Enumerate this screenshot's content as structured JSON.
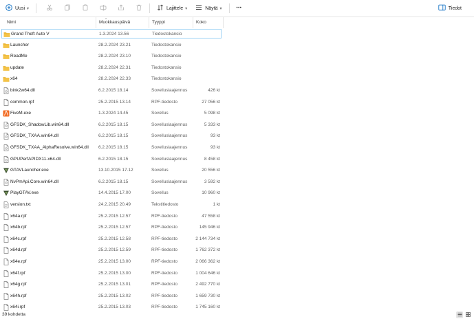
{
  "toolbar": {
    "new_label": "Uusi",
    "sort_label": "Lajittele",
    "view_label": "Näytä",
    "more_label": "•••",
    "details_label": "Tiedot"
  },
  "columns": {
    "name": "Nimi",
    "modified": "Muokkauspäivä",
    "type": "Tyyppi",
    "size": "Koko"
  },
  "files": [
    {
      "name": "Grand Theft Auto V",
      "modified": "1.3.2024 13.56",
      "type": "Tiedostokansio",
      "size": "",
      "icon": "folder-icon"
    },
    {
      "name": "Launcher",
      "modified": "28.2.2024 23.21",
      "type": "Tiedostokansio",
      "size": "",
      "icon": "folder-icon"
    },
    {
      "name": "ReadMe",
      "modified": "28.2.2024 23.10",
      "type": "Tiedostokansio",
      "size": "",
      "icon": "folder-icon"
    },
    {
      "name": "update",
      "modified": "28.2.2024 22.31",
      "type": "Tiedostokansio",
      "size": "",
      "icon": "folder-icon"
    },
    {
      "name": "x64",
      "modified": "28.2.2024 22.33",
      "type": "Tiedostokansio",
      "size": "",
      "icon": "folder-icon"
    },
    {
      "name": "bink2w64.dll",
      "modified": "6.2.2015 18.14",
      "type": "Sovelluslaajennus",
      "size": "426 kt",
      "icon": "dll-file-icon"
    },
    {
      "name": "common.rpf",
      "modified": "25.2.2015 13.14",
      "type": "RPF-tiedosto",
      "size": "27 056 kt",
      "icon": "file-icon"
    },
    {
      "name": "FiveM.exe",
      "modified": "1.3.2024 14.45",
      "type": "Sovellus",
      "size": "5 098 kt",
      "icon": "fivem-app-icon"
    },
    {
      "name": "GFSDK_ShadowLib.win64.dll",
      "modified": "6.2.2015 18.15",
      "type": "Sovelluslaajennus",
      "size": "5 333 kt",
      "icon": "dll-file-icon"
    },
    {
      "name": "GFSDK_TXAA.win64.dll",
      "modified": "6.2.2015 18.15",
      "type": "Sovelluslaajennus",
      "size": "93 kt",
      "icon": "dll-file-icon"
    },
    {
      "name": "GFSDK_TXAA_AlphaResolve.win64.dll",
      "modified": "6.2.2015 18.15",
      "type": "Sovelluslaajennus",
      "size": "93 kt",
      "icon": "dll-file-icon"
    },
    {
      "name": "GPUPerfAPIDX11-x64.dll",
      "modified": "6.2.2015 18.15",
      "type": "Sovelluslaajennus",
      "size": "8 458 kt",
      "icon": "dll-file-icon"
    },
    {
      "name": "GTAVLauncher.exe",
      "modified": "13.10.2015 17.12",
      "type": "Sovellus",
      "size": "20 556 kt",
      "icon": "gtav-app-icon"
    },
    {
      "name": "NvPmApi.Core.win64.dll",
      "modified": "6.2.2015 18.15",
      "type": "Sovelluslaajennus",
      "size": "3 592 kt",
      "icon": "dll-file-icon"
    },
    {
      "name": "PlayGTAV.exe",
      "modified": "14.4.2015 17.00",
      "type": "Sovellus",
      "size": "10 960 kt",
      "icon": "gtav-app-icon"
    },
    {
      "name": "version.txt",
      "modified": "24.2.2015 20.49",
      "type": "Tekstitiedosto",
      "size": "1 kt",
      "icon": "text-file-icon"
    },
    {
      "name": "x64a.rpf",
      "modified": "25.2.2015 12.57",
      "type": "RPF-tiedosto",
      "size": "47 558 kt",
      "icon": "file-icon"
    },
    {
      "name": "x64b.rpf",
      "modified": "25.2.2015 12.57",
      "type": "RPF-tiedosto",
      "size": "145 946 kt",
      "icon": "file-icon"
    },
    {
      "name": "x64c.rpf",
      "modified": "25.2.2015 12.58",
      "type": "RPF-tiedosto",
      "size": "2 144 734 kt",
      "icon": "file-icon"
    },
    {
      "name": "x64d.rpf",
      "modified": "25.2.2015 12.59",
      "type": "RPF-tiedosto",
      "size": "1 762 372 kt",
      "icon": "file-icon"
    },
    {
      "name": "x64e.rpf",
      "modified": "25.2.2015 13.00",
      "type": "RPF-tiedosto",
      "size": "2 066 362 kt",
      "icon": "file-icon"
    },
    {
      "name": "x64f.rpf",
      "modified": "25.2.2015 13.00",
      "type": "RPF-tiedosto",
      "size": "1 004 646 kt",
      "icon": "file-icon"
    },
    {
      "name": "x64g.rpf",
      "modified": "25.2.2015 13.01",
      "type": "RPF-tiedosto",
      "size": "2 492 770 kt",
      "icon": "file-icon"
    },
    {
      "name": "x64h.rpf",
      "modified": "25.2.2015 13.02",
      "type": "RPF-tiedosto",
      "size": "1 659 730 kt",
      "icon": "file-icon"
    },
    {
      "name": "x64i.rpf",
      "modified": "25.2.2015 13.03",
      "type": "RPF-tiedosto",
      "size": "1 745 160 kt",
      "icon": "file-icon"
    }
  ],
  "status": {
    "item_count": "39 kohdetta"
  },
  "colors": {
    "folder": "#f4c347",
    "folder_dark": "#e3a81b",
    "selection_border": "#9fd3f5",
    "accent": "#0067c0"
  }
}
